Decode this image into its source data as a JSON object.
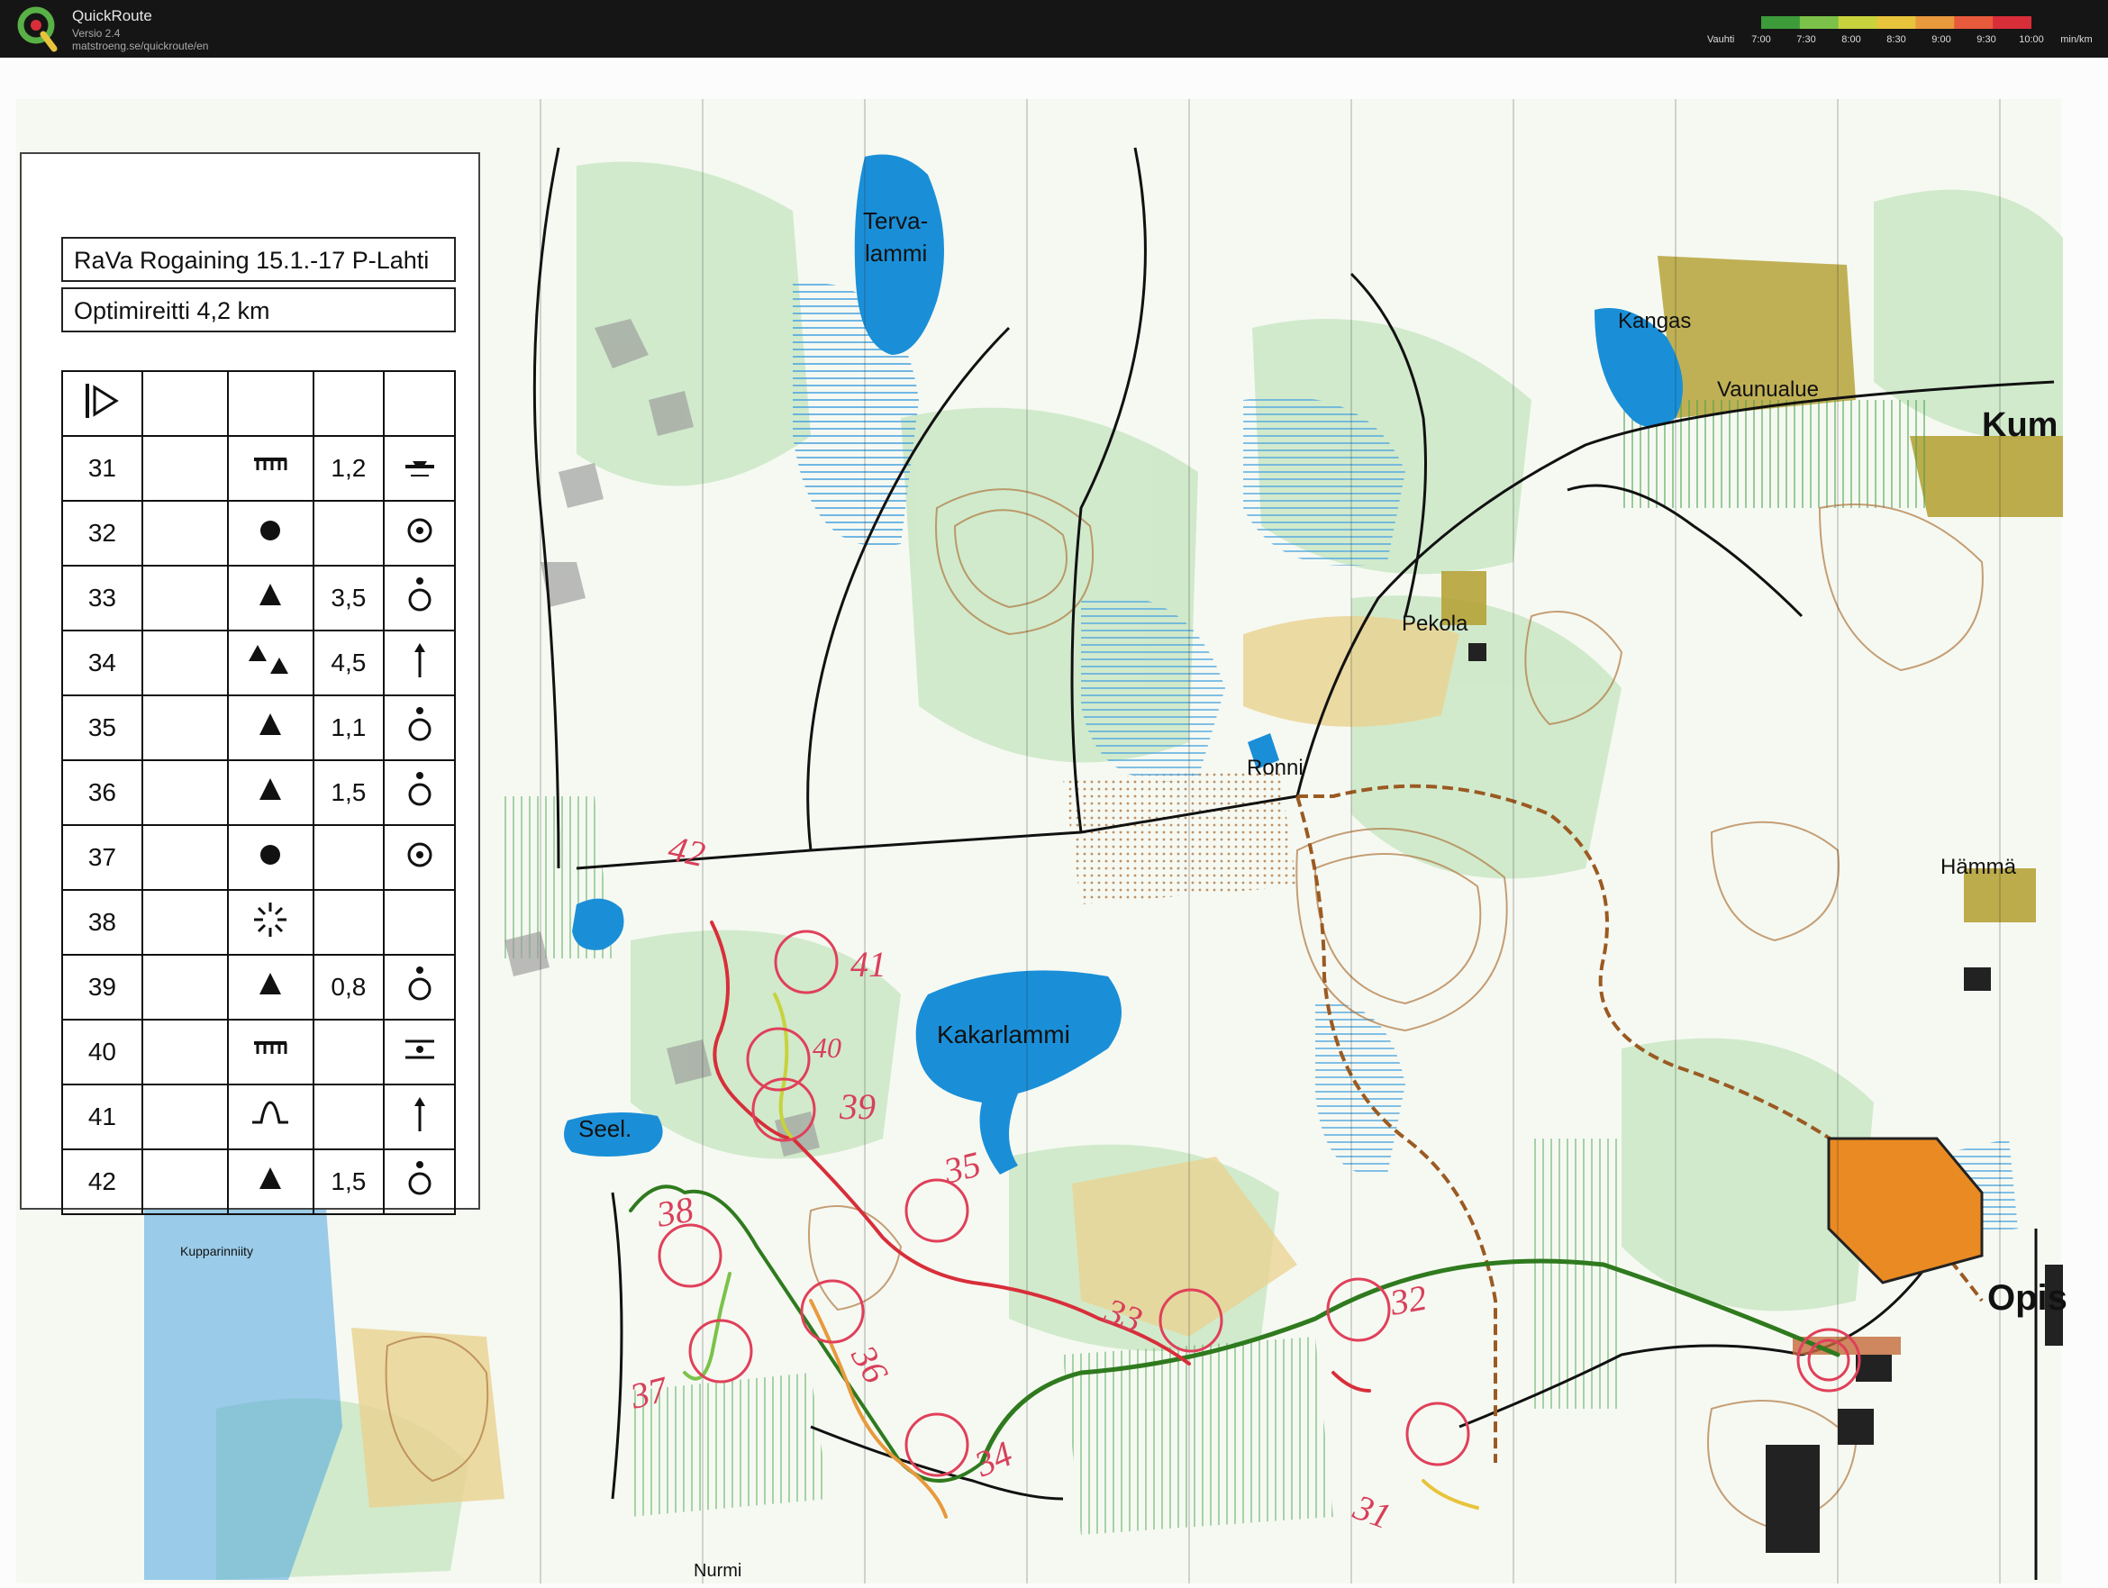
{
  "app": {
    "title": "QuickRoute",
    "version": "Versio 2.4",
    "url": "matstroeng.se/quickroute/en"
  },
  "pace_legend": {
    "label": "Vauhti",
    "ticks": [
      "7:00",
      "7:30",
      "8:00",
      "8:30",
      "9:00",
      "9:30",
      "10:00"
    ],
    "unit": "min/km",
    "colors": [
      "#3d9b3a",
      "#7cc24a",
      "#c8d23c",
      "#e8c43c",
      "#e89a3c",
      "#e85a3c",
      "#d82e3a"
    ]
  },
  "colors": {
    "forest": "#ffffff",
    "open_green": "#cfe9c9",
    "water": "#1a8fd8",
    "marsh_blue": "#4ea6e0",
    "yellow_open": "#ead28f",
    "built_area": "#b6a33a",
    "contour": "#b07740",
    "route_green": "#2f7a1e",
    "route_red": "#d82e3a",
    "control_circle": "#e0405a",
    "orange_area": "#ea8a23",
    "dark_building": "#222222"
  },
  "control_description": {
    "title": "RaVa Rogaining 15.1.-17 P-Lahti",
    "subtitle": "Optimireitti 4,2 km",
    "header_symbol": "start-triangle-icon",
    "rows": [
      {
        "num": "31",
        "feature": "earth-bank-icon",
        "dim": "1,2",
        "extra": "foot-of-icon"
      },
      {
        "num": "32",
        "feature": "knoll-dot-icon",
        "dim": "",
        "extra": "centre-icon"
      },
      {
        "num": "33",
        "feature": "boulder-icon",
        "dim": "3,5",
        "extra": "side-icon"
      },
      {
        "num": "34",
        "feature": "boulder-group-icon",
        "dim": "4,5",
        "extra": "north-arrow-icon"
      },
      {
        "num": "35",
        "feature": "boulder-icon",
        "dim": "1,1",
        "extra": "side-icon"
      },
      {
        "num": "36",
        "feature": "boulder-icon",
        "dim": "1,5",
        "extra": "side-icon"
      },
      {
        "num": "37",
        "feature": "knoll-dot-icon",
        "dim": "",
        "extra": "centre-icon"
      },
      {
        "num": "38",
        "feature": "special-feature-icon",
        "dim": "",
        "extra": ""
      },
      {
        "num": "39",
        "feature": "boulder-icon",
        "dim": "0,8",
        "extra": "side-icon"
      },
      {
        "num": "40",
        "feature": "earth-bank-icon",
        "dim": "",
        "extra": "middle-icon"
      },
      {
        "num": "41",
        "feature": "gully-icon",
        "dim": "",
        "extra": "north-arrow-icon"
      },
      {
        "num": "42",
        "feature": "boulder-icon",
        "dim": "1,5",
        "extra": "side-icon"
      }
    ]
  },
  "map_labels": {
    "terva1": "Terva-",
    "terva2": "lammi",
    "kangas": "Kangas",
    "vaunualue": "Vaunualue",
    "kum": "Kum",
    "pekola": "Pekola",
    "ronni": "Ronni",
    "hamma": "Hämmä",
    "kakarlammi": "Kakarlammi",
    "seel": "Seel.",
    "kupparinniity": "Kupparinniity",
    "opis": "Opis",
    "nurmi": "Nurmi"
  },
  "controls_handwritten": {
    "c42": "42",
    "c41": "41",
    "c40": "40",
    "c39": "39",
    "c35": "35",
    "c38": "38",
    "c36": "36",
    "c37": "37",
    "c34": "34",
    "c33": "33",
    "c32": "32",
    "c31": "31"
  }
}
